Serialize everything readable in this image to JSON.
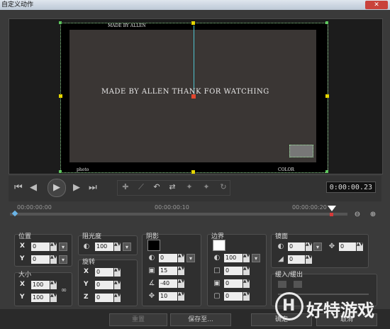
{
  "window": {
    "title": "自定义动作",
    "close_icon": "close-icon"
  },
  "video": {
    "caption_top": "MADE BY ALLEN",
    "main_text": "MADE BY ALLEN THANK FOR WATCHING",
    "label_bottom_left": "photo",
    "label_bottom_right": "COLOR"
  },
  "playback": {
    "timecode": "0:00:00.23",
    "ruler": [
      "00:00:00:00",
      "00:00:00:10",
      "00:00:00:20"
    ]
  },
  "panels": {
    "position": {
      "title": "位置",
      "x_label": "X",
      "x_value": "0",
      "y_label": "Y",
      "y_value": "0"
    },
    "size": {
      "title": "大小",
      "x_label": "X",
      "x_value": "100",
      "y_label": "Y",
      "y_value": "100"
    },
    "opacity": {
      "title": "阻光度",
      "value": "100"
    },
    "rotation": {
      "title": "旋转",
      "x_label": "X",
      "x_value": "0",
      "y_label": "Y",
      "y_value": "0",
      "z_label": "Z",
      "z_value": "0"
    },
    "shadow": {
      "title": "阴影",
      "color": "#000000",
      "v1": "0",
      "v2": "15",
      "v3": "-40",
      "v4": "10"
    },
    "border": {
      "title": "边界",
      "color": "#ffffff",
      "v1": "100",
      "v2": "0",
      "v3": "0",
      "v4": "0"
    },
    "mirror": {
      "title": "镜面",
      "v1": "0",
      "v2": "0",
      "v3": "0"
    },
    "fade": {
      "title": "缓入/缓出"
    }
  },
  "buttons": {
    "reset": "重置",
    "save_as": "保存至...",
    "ok": "确定",
    "cancel": "取消"
  },
  "watermark": {
    "text": "好特游戏"
  }
}
